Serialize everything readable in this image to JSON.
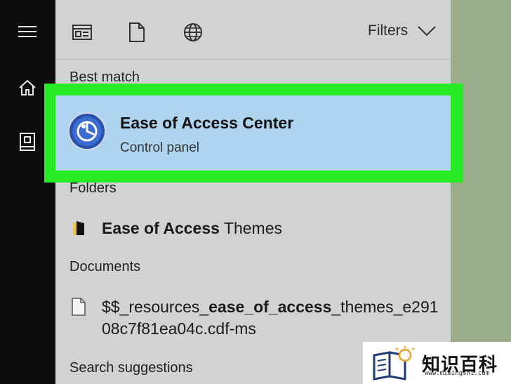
{
  "sidebar": {
    "items": [
      {
        "icon": "hamburger-icon"
      },
      {
        "icon": "home-icon"
      },
      {
        "icon": "notebook-icon"
      }
    ]
  },
  "toolbar": {
    "icons": [
      "apps-filter-icon",
      "documents-filter-icon",
      "web-filter-icon"
    ],
    "filters_label": "Filters"
  },
  "sections": {
    "best_match": "Best match",
    "folders": "Folders",
    "documents": "Documents",
    "search_suggestions": "Search suggestions"
  },
  "best_match": {
    "title": "Ease of Access Center",
    "subtitle": "Control panel",
    "icon": "ease-of-access-icon",
    "highlight_color": "#25ea25"
  },
  "folders": [
    {
      "bold": "Ease of Access",
      "rest": " Themes",
      "icon": "folder-icon"
    }
  ],
  "documents": [
    {
      "line1_parts": [
        {
          "text": "$$_resources_",
          "bold": false
        },
        {
          "text": "ease_of_access",
          "bold": true
        },
        {
          "text": "_themes_e291",
          "bold": false
        }
      ],
      "line2": "08c7f81ea04c.cdf-ms",
      "icon": "document-icon"
    }
  ],
  "watermark": {
    "text": "知识百科",
    "url": "www.mimingshi.com"
  }
}
